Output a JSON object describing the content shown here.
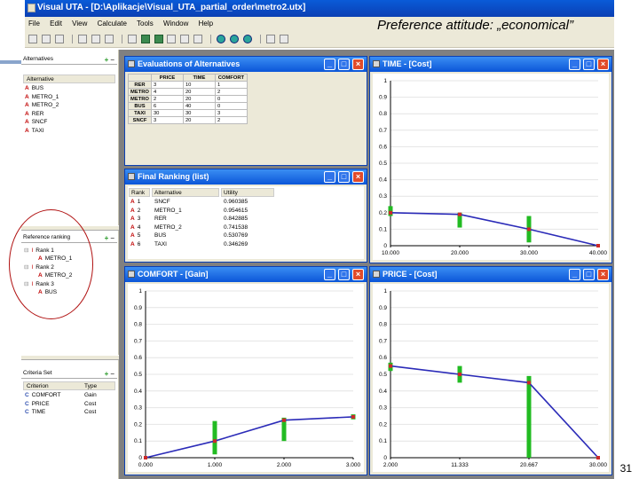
{
  "app": {
    "title": "Visual UTA - [D:\\Aplikacje\\Visual_UTA_partial_order\\metro2.utx]",
    "menu": [
      "File",
      "Edit",
      "View",
      "Calculate",
      "Tools",
      "Window",
      "Help"
    ]
  },
  "slide_title": "Preference attitude: „economical”",
  "page_number": "31",
  "alternatives_panel": {
    "title": "Alternatives",
    "column": "Alternative",
    "items": [
      "BUS",
      "METRO_1",
      "METRO_2",
      "RER",
      "SNCF",
      "TAXI"
    ],
    "tag": "A"
  },
  "reference_panel": {
    "title": "Reference ranking",
    "items": [
      {
        "rank": "Rank 1",
        "alts": [
          "METRO_1"
        ]
      },
      {
        "rank": "Rank 2",
        "alts": [
          "METRO_2"
        ]
      },
      {
        "rank": "Rank 3",
        "alts": [
          "BUS"
        ]
      }
    ]
  },
  "criteria_panel": {
    "title": "Criteria Set",
    "columns": [
      "Criterion",
      "Type"
    ],
    "rows": [
      {
        "name": "COMFORT",
        "type": "Gain"
      },
      {
        "name": "PRICE",
        "type": "Cost"
      },
      {
        "name": "TIME",
        "type": "Cost"
      }
    ]
  },
  "evaluations_window": {
    "title": "Evaluations of Alternatives",
    "columns": [
      "PRICE",
      "TIME",
      "COMFORT"
    ],
    "rows": [
      {
        "name": "RER",
        "values": [
          "3",
          "10",
          "1"
        ]
      },
      {
        "name": "METRO",
        "values": [
          "4",
          "20",
          "2"
        ]
      },
      {
        "name": "METRO",
        "values": [
          "2",
          "20",
          "0"
        ]
      },
      {
        "name": "BUS",
        "values": [
          "6",
          "40",
          "0"
        ]
      },
      {
        "name": "TAXI",
        "values": [
          "30",
          "30",
          "3"
        ]
      },
      {
        "name": "SNCF",
        "values": [
          "3",
          "20",
          "2"
        ]
      }
    ]
  },
  "ranking_window": {
    "title": "Final Ranking (list)",
    "columns": [
      "Rank",
      "Alternative",
      "Utility"
    ],
    "rows": [
      {
        "rank": "1",
        "alt": "SNCF",
        "utility": "0.960385"
      },
      {
        "rank": "2",
        "alt": "METRO_1",
        "utility": "0.954615"
      },
      {
        "rank": "3",
        "alt": "RER",
        "utility": "0.842885"
      },
      {
        "rank": "4",
        "alt": "METRO_2",
        "utility": "0.741538"
      },
      {
        "rank": "5",
        "alt": "BUS",
        "utility": "0.530769"
      },
      {
        "rank": "6",
        "alt": "TAXI",
        "utility": "0.346269"
      }
    ]
  },
  "colors": {
    "line": "#2b2bb8",
    "bar": "#22bb22",
    "point": "#cc2a2a"
  },
  "chart_data": [
    {
      "type": "line",
      "window_title": "TIME - [Cost]",
      "x_ticks": [
        "10.000",
        "20.000",
        "30.000",
        "40.000"
      ],
      "y_ticks": [
        "0",
        "0.1",
        "0.2",
        "0.3",
        "0.4",
        "0.5",
        "0.6",
        "0.7",
        "0.8",
        "0.9",
        "1"
      ],
      "xlim": [
        10,
        40
      ],
      "ylim": [
        0,
        1
      ],
      "x": [
        10,
        20,
        30,
        40
      ],
      "y": [
        0.2,
        0.19,
        0.1,
        0.0
      ],
      "ranges": [
        [
          0.18,
          0.24
        ],
        [
          0.11,
          0.2
        ],
        [
          0.02,
          0.18
        ],
        null
      ]
    },
    {
      "type": "line",
      "window_title": "COMFORT - [Gain]",
      "x_ticks": [
        "0.000",
        "1.000",
        "2.000",
        "3.000"
      ],
      "y_ticks": [
        "0",
        "0.1",
        "0.2",
        "0.3",
        "0.4",
        "0.5",
        "0.6",
        "0.7",
        "0.8",
        "0.9",
        "1"
      ],
      "xlim": [
        0,
        3
      ],
      "ylim": [
        0,
        1
      ],
      "x": [
        0,
        1,
        2,
        3
      ],
      "y": [
        0.0,
        0.1,
        0.225,
        0.245
      ],
      "ranges": [
        null,
        [
          0.02,
          0.22
        ],
        [
          0.1,
          0.24
        ],
        [
          0.23,
          0.26
        ]
      ]
    },
    {
      "type": "line",
      "window_title": "PRICE - [Cost]",
      "x_ticks": [
        "2.000",
        "11.333",
        "20.667",
        "30.000"
      ],
      "y_ticks": [
        "0",
        "0.1",
        "0.2",
        "0.3",
        "0.4",
        "0.5",
        "0.6",
        "0.7",
        "0.8",
        "0.9",
        "1"
      ],
      "xlim": [
        2,
        30
      ],
      "ylim": [
        0,
        1
      ],
      "x": [
        2,
        11.333,
        20.667,
        30
      ],
      "y": [
        0.55,
        0.5,
        0.45,
        0.0
      ],
      "ranges": [
        [
          0.52,
          0.57
        ],
        [
          0.45,
          0.55
        ],
        [
          0.0,
          0.49
        ],
        null
      ]
    }
  ]
}
